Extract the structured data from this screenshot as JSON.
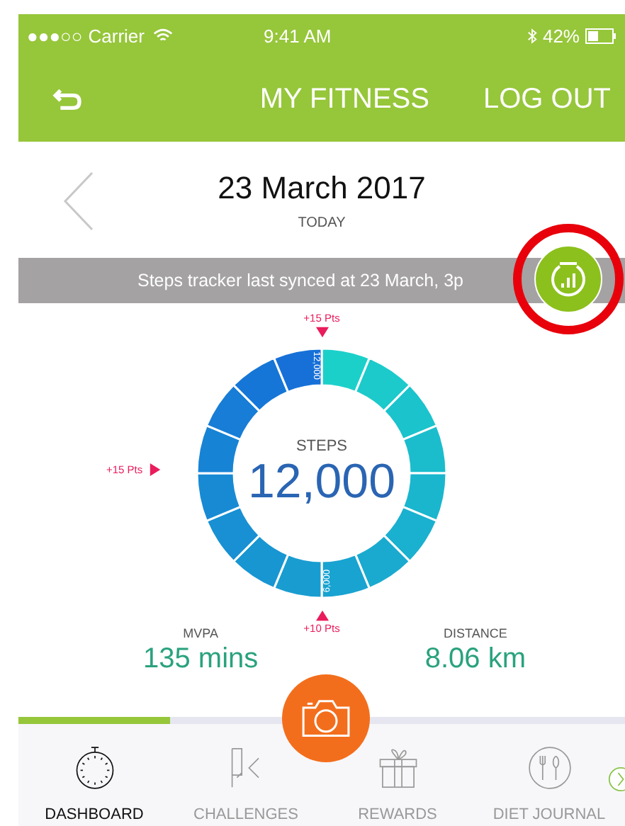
{
  "status_bar": {
    "signal": "●●●○○",
    "carrier": "Carrier",
    "time": "9:41 AM",
    "battery": "42%"
  },
  "nav": {
    "title": "MY FITNESS",
    "action": "LOG OUT"
  },
  "date": {
    "title": "23 March 2017",
    "subtitle": "TODAY"
  },
  "sync": {
    "message": "Steps tracker last synced at 23 March, 3p",
    "highlighted": true
  },
  "steps": {
    "label": "STEPS",
    "value": "12,000",
    "segment_labels": [
      "12,000",
      "6,000"
    ],
    "bonuses": [
      "+15 Pts",
      "+15 Pts",
      "+10 Pts"
    ]
  },
  "stats": [
    {
      "label": "MVPA",
      "value": "135 mins"
    },
    {
      "label": "DISTANCE",
      "value": "8.06 km"
    }
  ],
  "progress": {
    "level": 0.25
  },
  "tabs": [
    {
      "label": "DASHBOARD",
      "selected": true
    },
    {
      "label": "CHALLENGES",
      "selected": false
    },
    {
      "label": "REWARDS",
      "selected": false
    },
    {
      "label": "DIET JOURNAL",
      "selected": false
    }
  ]
}
